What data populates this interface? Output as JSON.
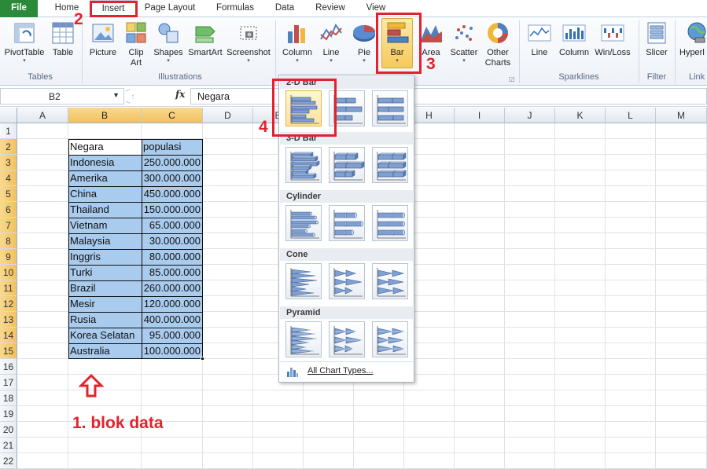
{
  "tabs": {
    "file": "File",
    "home": "Home",
    "insert": "Insert",
    "page_layout": "Page Layout",
    "formulas": "Formulas",
    "data": "Data",
    "review": "Review",
    "view": "View"
  },
  "ribbon": {
    "pivottable": "PivotTable",
    "table": "Table",
    "picture": "Picture",
    "clip_art_1": "Clip",
    "clip_art_2": "Art",
    "shapes": "Shapes",
    "smartart": "SmartArt",
    "screenshot": "Screenshot",
    "column": "Column",
    "line": "Line",
    "pie": "Pie",
    "bar": "Bar",
    "area": "Area",
    "scatter": "Scatter",
    "other_charts_1": "Other",
    "other_charts_2": "Charts",
    "spark_line": "Line",
    "spark_column": "Column",
    "spark_winloss": "Win/Loss",
    "slicer": "Slicer",
    "hyperlink": "Hyperl",
    "groups": {
      "tables": "Tables",
      "illustrations": "Illustrations",
      "sparklines": "Sparklines",
      "filter": "Filter",
      "links": "Link"
    }
  },
  "formula_bar": {
    "name_box": "B2",
    "fx": "fx",
    "value": "Negara"
  },
  "columns": [
    "A",
    "B",
    "C",
    "D",
    "E",
    "F",
    "G",
    "H",
    "I",
    "J",
    "K",
    "L",
    "M"
  ],
  "rows": [
    "1",
    "2",
    "3",
    "4",
    "5",
    "6",
    "7",
    "8",
    "9",
    "10",
    "11",
    "12",
    "13",
    "14",
    "15",
    "16",
    "17",
    "18",
    "19",
    "20",
    "21",
    "22"
  ],
  "table": {
    "headers": [
      "Negara",
      "populasi"
    ],
    "rows": [
      [
        "Indonesia",
        "250.000.000"
      ],
      [
        "Amerika",
        "300.000.000"
      ],
      [
        "China",
        "450.000.000"
      ],
      [
        "Thailand",
        "150.000.000"
      ],
      [
        "Vietnam",
        "65.000.000"
      ],
      [
        "Malaysia",
        "30.000.000"
      ],
      [
        "Inggris",
        "80.000.000"
      ],
      [
        "Turki",
        "85.000.000"
      ],
      [
        "Brazil",
        "260.000.000"
      ],
      [
        "Mesir",
        "120.000.000"
      ],
      [
        "Rusia",
        "400.000.000"
      ],
      [
        "Korea Selatan",
        "95.000.000"
      ],
      [
        "Australia",
        "100.000.000"
      ]
    ]
  },
  "gallery": {
    "sec_2d": "2-D Bar",
    "sec_3d": "3-D Bar",
    "sec_cylinder": "Cylinder",
    "sec_cone": "Cone",
    "sec_pyramid": "Pyramid",
    "all_chart_types": "All Chart Types..."
  },
  "annotations": {
    "step1": "1. blok data",
    "step2": "2",
    "step3": "3",
    "step4": "4"
  },
  "colors": {
    "accent_red": "#e3222d",
    "file_tab_green": "#2a8a3a",
    "selection_blue": "#a9cbee",
    "header_highlight": "#f1c160"
  }
}
